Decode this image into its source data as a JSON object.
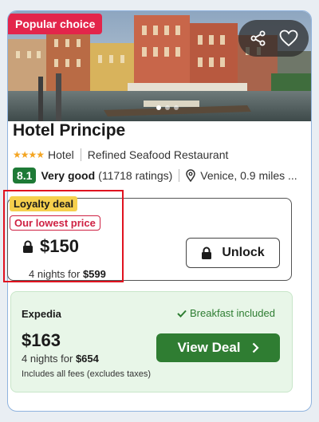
{
  "badges": {
    "popular": "Popular choice"
  },
  "icons": {
    "share": "share-icon",
    "favorite": "heart-icon",
    "location": "location-pin-icon",
    "lock": "lock-icon",
    "check": "check-icon",
    "chevron": "chevron-right-icon"
  },
  "gallery": {
    "total_dots": 3,
    "active_dot": 1
  },
  "hotel": {
    "name": "Hotel Principe",
    "stars": "★★★★",
    "star_count": 4,
    "type": "Hotel",
    "amenity": "Refined Seafood Restaurant",
    "score": "8.1",
    "rating_label": "Very good",
    "ratings_count": "(11718 ratings)",
    "location": "Venice, 0.9 miles ..."
  },
  "loyalty": {
    "tag": "Loyalty deal",
    "lowest_price_tag": "Our lowest price",
    "price": "$150",
    "nights_text": "4 nights for ",
    "total": "$599",
    "unlock_label": "Unlock"
  },
  "deal": {
    "provider": "Expedia",
    "breakfast": "Breakfast included",
    "price": "$163",
    "nights_text": "4 nights for ",
    "total": "$654",
    "fees_note": "Includes all fees (excludes taxes)",
    "view_label": "View Deal"
  },
  "colors": {
    "popular_badge": "#e3254b",
    "score_bg": "#1e7a36",
    "loyalty_tag": "#f6d04d",
    "lowest_tag": "#cf2143",
    "deal_bg": "#e8f6e8",
    "view_button": "#2f7d32",
    "highlight": "#e0121f"
  }
}
